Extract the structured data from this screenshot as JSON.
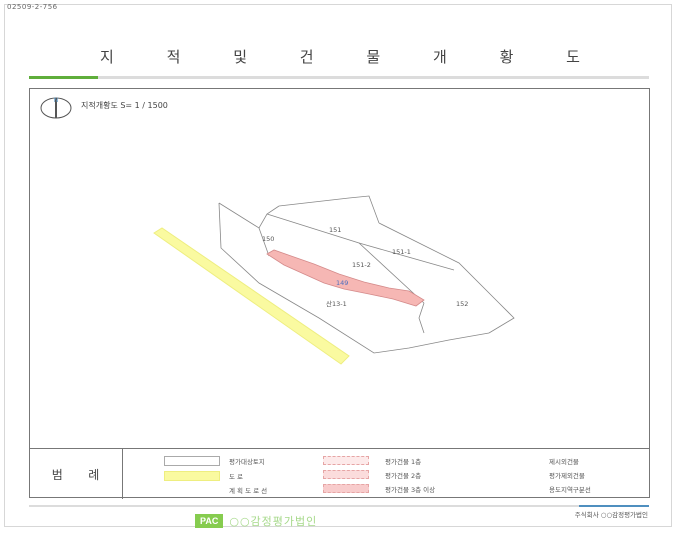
{
  "document_number": "02509-2-756",
  "title_chars": [
    "지",
    "적",
    "및",
    "건",
    "물",
    "개",
    "황",
    "도"
  ],
  "map": {
    "north_label": "N",
    "scale_text": "지적개황도 S= 1 / 1500",
    "parcels": [
      {
        "id": "150",
        "label": "150"
      },
      {
        "id": "151",
        "label": "151"
      },
      {
        "id": "151-1",
        "label": "151-1"
      },
      {
        "id": "151-2",
        "label": "151-2"
      },
      {
        "id": "149",
        "label": "149"
      },
      {
        "id": "san13-1",
        "label": "산13-1"
      },
      {
        "id": "152",
        "label": "152"
      }
    ]
  },
  "legend": {
    "label_chars": [
      "범",
      "례"
    ],
    "items": [
      {
        "id": "subject-site",
        "text": "평가대상토지"
      },
      {
        "id": "road",
        "text": "도    로"
      },
      {
        "id": "planned-road",
        "text": "계 획 도 로 선"
      },
      {
        "id": "building-1",
        "text": "평가건물 1층"
      },
      {
        "id": "building-2",
        "text": "평가건물 2층"
      },
      {
        "id": "building-3",
        "text": "평가건물 3층 이상"
      },
      {
        "id": "other-building",
        "text": "제시외건물"
      },
      {
        "id": "excluded-building",
        "text": "평가제외건물"
      },
      {
        "id": "road-boundary",
        "text": "용도지역구분선"
      }
    ]
  },
  "footer": {
    "company": "주식회사 ○○감정평가법인",
    "logo_text": "PAC",
    "firm_name": "○○감정평가법인"
  },
  "colors": {
    "accent_green": "#5fae3b",
    "accent_blue": "#4f8fbf",
    "subject_fill": "#f6b7b4",
    "road_fill": "#fafaa0"
  }
}
